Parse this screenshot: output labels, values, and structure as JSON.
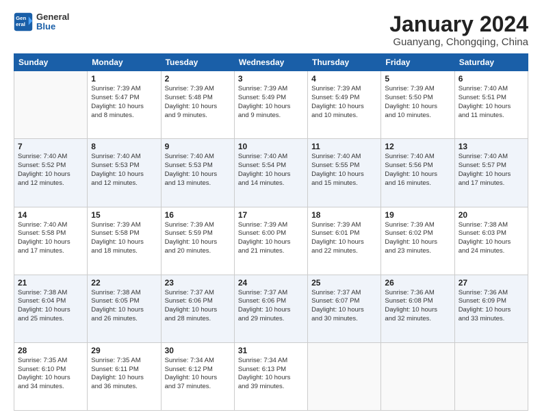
{
  "header": {
    "logo": {
      "general": "General",
      "blue": "Blue"
    },
    "title": "January 2024",
    "location": "Guanyang, Chongqing, China"
  },
  "weekdays": [
    "Sunday",
    "Monday",
    "Tuesday",
    "Wednesday",
    "Thursday",
    "Friday",
    "Saturday"
  ],
  "weeks": [
    [
      {
        "date": "",
        "info": ""
      },
      {
        "date": "1",
        "info": "Sunrise: 7:39 AM\nSunset: 5:47 PM\nDaylight: 10 hours\nand 8 minutes."
      },
      {
        "date": "2",
        "info": "Sunrise: 7:39 AM\nSunset: 5:48 PM\nDaylight: 10 hours\nand 9 minutes."
      },
      {
        "date": "3",
        "info": "Sunrise: 7:39 AM\nSunset: 5:49 PM\nDaylight: 10 hours\nand 9 minutes."
      },
      {
        "date": "4",
        "info": "Sunrise: 7:39 AM\nSunset: 5:49 PM\nDaylight: 10 hours\nand 10 minutes."
      },
      {
        "date": "5",
        "info": "Sunrise: 7:39 AM\nSunset: 5:50 PM\nDaylight: 10 hours\nand 10 minutes."
      },
      {
        "date": "6",
        "info": "Sunrise: 7:40 AM\nSunset: 5:51 PM\nDaylight: 10 hours\nand 11 minutes."
      }
    ],
    [
      {
        "date": "7",
        "info": "Sunrise: 7:40 AM\nSunset: 5:52 PM\nDaylight: 10 hours\nand 12 minutes."
      },
      {
        "date": "8",
        "info": "Sunrise: 7:40 AM\nSunset: 5:53 PM\nDaylight: 10 hours\nand 12 minutes."
      },
      {
        "date": "9",
        "info": "Sunrise: 7:40 AM\nSunset: 5:53 PM\nDaylight: 10 hours\nand 13 minutes."
      },
      {
        "date": "10",
        "info": "Sunrise: 7:40 AM\nSunset: 5:54 PM\nDaylight: 10 hours\nand 14 minutes."
      },
      {
        "date": "11",
        "info": "Sunrise: 7:40 AM\nSunset: 5:55 PM\nDaylight: 10 hours\nand 15 minutes."
      },
      {
        "date": "12",
        "info": "Sunrise: 7:40 AM\nSunset: 5:56 PM\nDaylight: 10 hours\nand 16 minutes."
      },
      {
        "date": "13",
        "info": "Sunrise: 7:40 AM\nSunset: 5:57 PM\nDaylight: 10 hours\nand 17 minutes."
      }
    ],
    [
      {
        "date": "14",
        "info": "Sunrise: 7:40 AM\nSunset: 5:58 PM\nDaylight: 10 hours\nand 17 minutes."
      },
      {
        "date": "15",
        "info": "Sunrise: 7:39 AM\nSunset: 5:58 PM\nDaylight: 10 hours\nand 18 minutes."
      },
      {
        "date": "16",
        "info": "Sunrise: 7:39 AM\nSunset: 5:59 PM\nDaylight: 10 hours\nand 20 minutes."
      },
      {
        "date": "17",
        "info": "Sunrise: 7:39 AM\nSunset: 6:00 PM\nDaylight: 10 hours\nand 21 minutes."
      },
      {
        "date": "18",
        "info": "Sunrise: 7:39 AM\nSunset: 6:01 PM\nDaylight: 10 hours\nand 22 minutes."
      },
      {
        "date": "19",
        "info": "Sunrise: 7:39 AM\nSunset: 6:02 PM\nDaylight: 10 hours\nand 23 minutes."
      },
      {
        "date": "20",
        "info": "Sunrise: 7:38 AM\nSunset: 6:03 PM\nDaylight: 10 hours\nand 24 minutes."
      }
    ],
    [
      {
        "date": "21",
        "info": "Sunrise: 7:38 AM\nSunset: 6:04 PM\nDaylight: 10 hours\nand 25 minutes."
      },
      {
        "date": "22",
        "info": "Sunrise: 7:38 AM\nSunset: 6:05 PM\nDaylight: 10 hours\nand 26 minutes."
      },
      {
        "date": "23",
        "info": "Sunrise: 7:37 AM\nSunset: 6:06 PM\nDaylight: 10 hours\nand 28 minutes."
      },
      {
        "date": "24",
        "info": "Sunrise: 7:37 AM\nSunset: 6:06 PM\nDaylight: 10 hours\nand 29 minutes."
      },
      {
        "date": "25",
        "info": "Sunrise: 7:37 AM\nSunset: 6:07 PM\nDaylight: 10 hours\nand 30 minutes."
      },
      {
        "date": "26",
        "info": "Sunrise: 7:36 AM\nSunset: 6:08 PM\nDaylight: 10 hours\nand 32 minutes."
      },
      {
        "date": "27",
        "info": "Sunrise: 7:36 AM\nSunset: 6:09 PM\nDaylight: 10 hours\nand 33 minutes."
      }
    ],
    [
      {
        "date": "28",
        "info": "Sunrise: 7:35 AM\nSunset: 6:10 PM\nDaylight: 10 hours\nand 34 minutes."
      },
      {
        "date": "29",
        "info": "Sunrise: 7:35 AM\nSunset: 6:11 PM\nDaylight: 10 hours\nand 36 minutes."
      },
      {
        "date": "30",
        "info": "Sunrise: 7:34 AM\nSunset: 6:12 PM\nDaylight: 10 hours\nand 37 minutes."
      },
      {
        "date": "31",
        "info": "Sunrise: 7:34 AM\nSunset: 6:13 PM\nDaylight: 10 hours\nand 39 minutes."
      },
      {
        "date": "",
        "info": ""
      },
      {
        "date": "",
        "info": ""
      },
      {
        "date": "",
        "info": ""
      }
    ]
  ]
}
